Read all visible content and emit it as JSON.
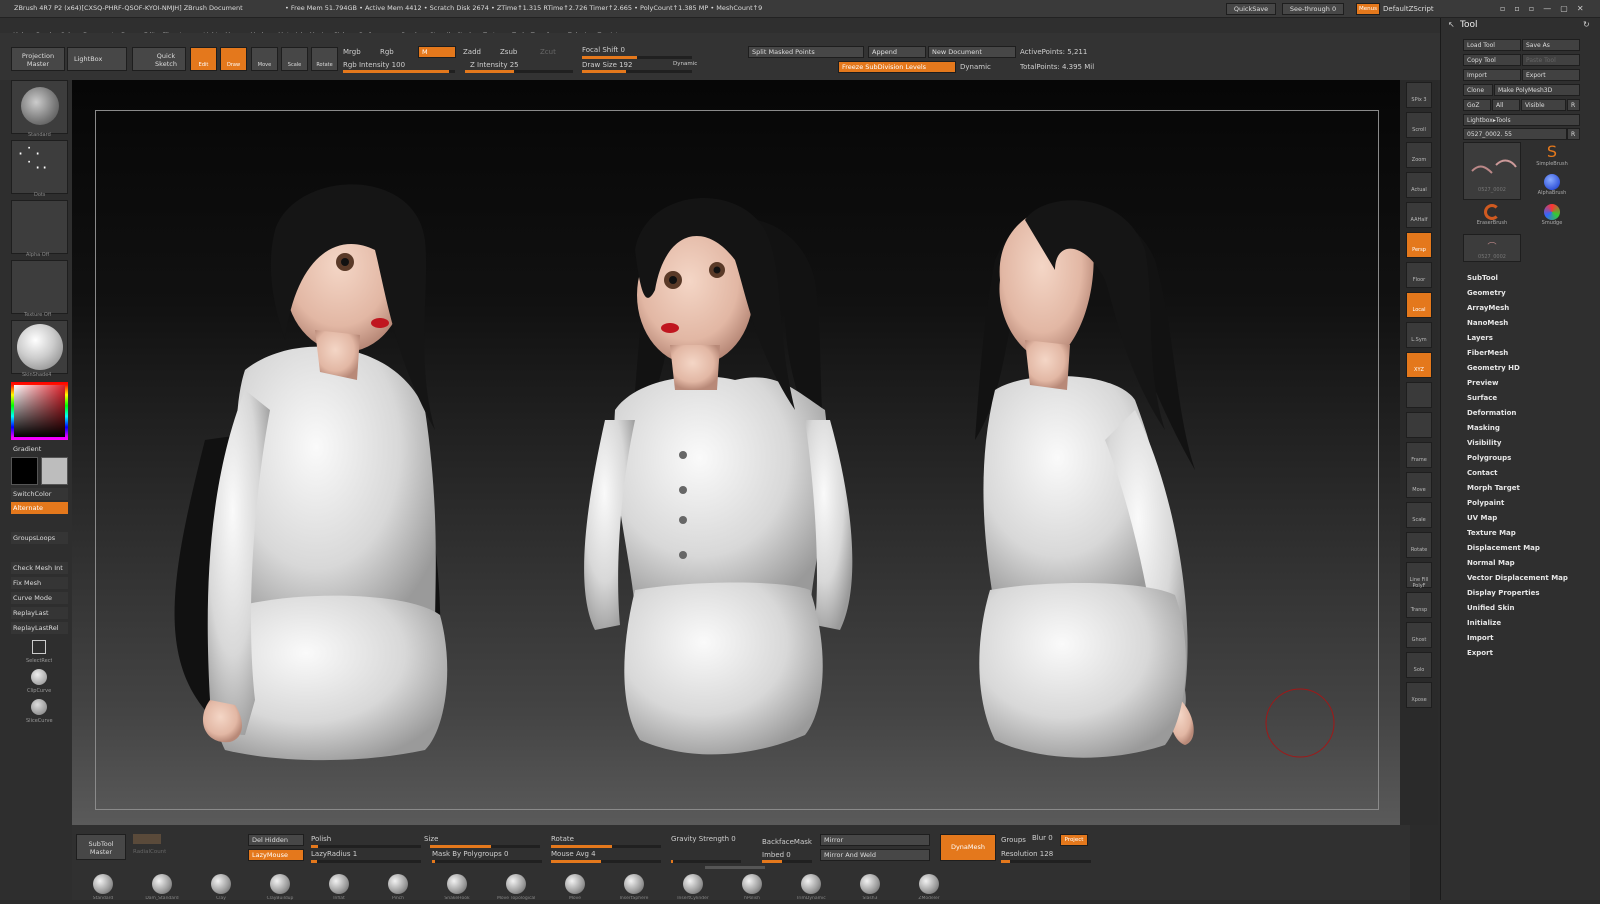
{
  "titlebar": {
    "title": "ZBrush 4R7 P2 (x64)[CXSQ-PHRF-QSOF-KYOI-NMJH]   ZBrush Document",
    "mem": "• Free Mem 51.794GB • Active Mem 4412 • Scratch Disk 2674 • ZTime↑1.315 RTime↑2.726 Timer↑2.665 • PolyCount↑1.385 MP • MeshCount↑9",
    "quicksave": "QuickSave",
    "seethrough": "See-through  0",
    "menus": "Menus",
    "script": "DefaultZScript"
  },
  "menubar": [
    "Alpha",
    "Brush",
    "Color",
    "Document",
    "Draw",
    "Edit",
    "File",
    "Layer",
    "Light",
    "Macro",
    "Marker",
    "Material",
    "Movie",
    "Picker",
    "Preferences",
    "Render",
    "Stencil",
    "Stroke",
    "Texture",
    "Tool",
    "Transform",
    "Zplugin",
    "Zscript"
  ],
  "topshelf": {
    "projection": "Projection Master",
    "lightbox": "LightBox",
    "quicksketch": "Quick Sketch",
    "edit": "Edit",
    "draw": "Draw",
    "move": "Move",
    "scale": "Scale",
    "rotate": "Rotate",
    "mrgb": "Mrgb",
    "rgb": "Rgb",
    "m": "M",
    "rgb_intensity": "Rgb Intensity 100",
    "zadd": "Zadd",
    "zsub": "Zsub",
    "zcut": "Zcut",
    "z_intensity": "Z Intensity 25",
    "focal_shift": "Focal Shift 0",
    "draw_size": "Draw Size 192",
    "dynamic": "Dynamic",
    "split_masked": "Split Masked Points",
    "append": "Append",
    "new_document": "New Document",
    "freeze": "Freeze SubDivision Levels",
    "dynamic2": "Dynamic",
    "active_points": "ActivePoints: 5,211",
    "total_points": "TotalPoints: 4.395 Mil"
  },
  "leftshelf": {
    "standard": "Standard",
    "dots": "Dots",
    "alpha_off": "Alpha Off",
    "texture_off": "Texture Off",
    "matcap": "SkinShade4",
    "gradient": "Gradient",
    "switchcolor": "SwitchColor",
    "alternate": "Alternate",
    "grouploops": "GroupsLoops",
    "check_mesh": "Check Mesh Int",
    "fix_mesh": "Fix Mesh",
    "curve_mode": "Curve Mode",
    "replay_last": "ReplayLast",
    "replay_last_rel": "ReplayLastRel",
    "selectrect": "SelectRect",
    "clipcurve": "ClipCurve",
    "slicecurve": "SliceCurve"
  },
  "rightshelf": [
    "SPix 3",
    "Scroll",
    "Zoom",
    "Actual",
    "AAHalf",
    "Persp",
    "Floor",
    "Local",
    "L.Sym",
    "XYZ",
    "",
    "",
    "Frame",
    "Move",
    "Scale",
    "Rotate",
    "Line Fill PolyF",
    "Transp",
    "Ghost",
    "Solo",
    "Xpose"
  ],
  "toolpanel": {
    "title": "Tool",
    "load": "Load Tool",
    "saveas": "Save As",
    "copy": "Copy Tool",
    "paste": "Paste Tool",
    "import": "Import",
    "export": "Export",
    "clone": "Clone",
    "make_poly": "Make PolyMesh3D",
    "goz": "GoZ",
    "all": "All",
    "visible": "Visible",
    "r": "R",
    "lightbox_tools": "Lightbox▸Tools",
    "current_tool": "0527_0002. 55",
    "r2": "R",
    "thumbs": [
      "0527_0002",
      "SimpleBrush",
      "AlphaBrush",
      "EraserBrush",
      "Smudge",
      "0527_0002"
    ],
    "sections": [
      "SubTool",
      "Geometry",
      "ArrayMesh",
      "NanoMesh",
      "Layers",
      "FiberMesh",
      "Geometry HD",
      "Preview",
      "Surface",
      "Deformation",
      "Masking",
      "Visibility",
      "Polygroups",
      "Contact",
      "Morph Target",
      "Polypaint",
      "UV Map",
      "Texture Map",
      "Displacement Map",
      "Normal Map",
      "Vector Displacement Map",
      "Display Properties",
      "Unified Skin",
      "Initialize",
      "Import",
      "Export"
    ]
  },
  "bottomshelf": {
    "subtool_master": "SubTool Master",
    "radial": "RadialCount",
    "del_hidden": "Del Hidden",
    "lazymouse": "LazyMouse",
    "polish": "Polish",
    "lazyradius": "LazyRadius 1",
    "size": "Size",
    "mask_polygroups": "Mask By Polygroups 0",
    "rotate": "Rotate",
    "mouse_avg": "Mouse Avg 4",
    "gravity": "Gravity Strength 0",
    "backfacemask": "BackfaceMask",
    "imbed": "Imbed 0",
    "mirror": "Mirror",
    "mirror_weld": "Mirror And Weld",
    "dynamesh": "DynaMesh",
    "groups": "Groups",
    "blur": "Blur 0",
    "project": "Project",
    "resolution": "Resolution 128",
    "brushes": [
      "Standard",
      "Dam_Standard",
      "Clay",
      "ClayBuildup",
      "Inflat",
      "Pinch",
      "SnakeHook",
      "Move Topological",
      "Move",
      "InsertSphere",
      "InsertCylinder",
      "hPolish",
      "TrimDynamic",
      "Slash3",
      "ZModeler"
    ]
  },
  "colors": {
    "accent": "#e4781c"
  }
}
